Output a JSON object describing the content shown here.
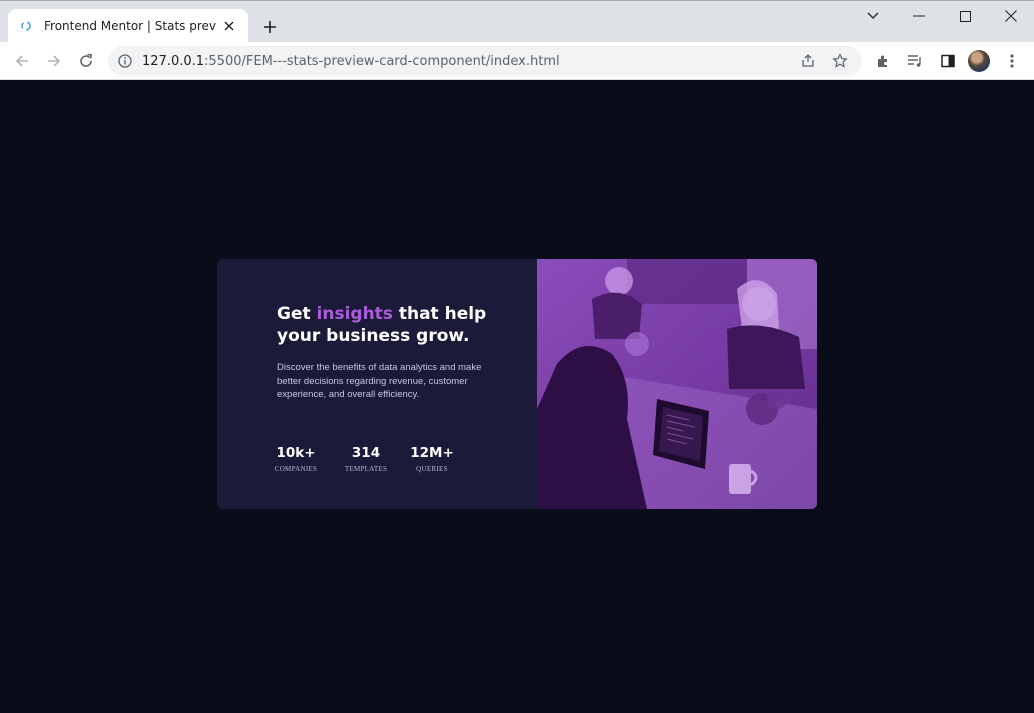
{
  "browser": {
    "tab_title": "Frontend Mentor | Stats preview c",
    "url_host": "127.0.0.1",
    "url_path": ":5500/FEM---stats-preview-card-component/index.html"
  },
  "card": {
    "headline_pre": "Get ",
    "headline_accent": "insights",
    "headline_post": " that help your business grow.",
    "description": "Discover the benefits of data analytics and make better decisions regarding revenue, customer experience, and overall efficiency.",
    "stats": [
      {
        "value": "10k+",
        "label": "COMPANIES"
      },
      {
        "value": "314",
        "label": "TEMPLATES"
      },
      {
        "value": "12M+",
        "label": "QUERIES"
      }
    ]
  },
  "colors": {
    "page_bg": "#0a0c19",
    "card_bg": "#1c1a39",
    "accent": "#aa5cdb",
    "image_tint": "#7a3fa3"
  }
}
